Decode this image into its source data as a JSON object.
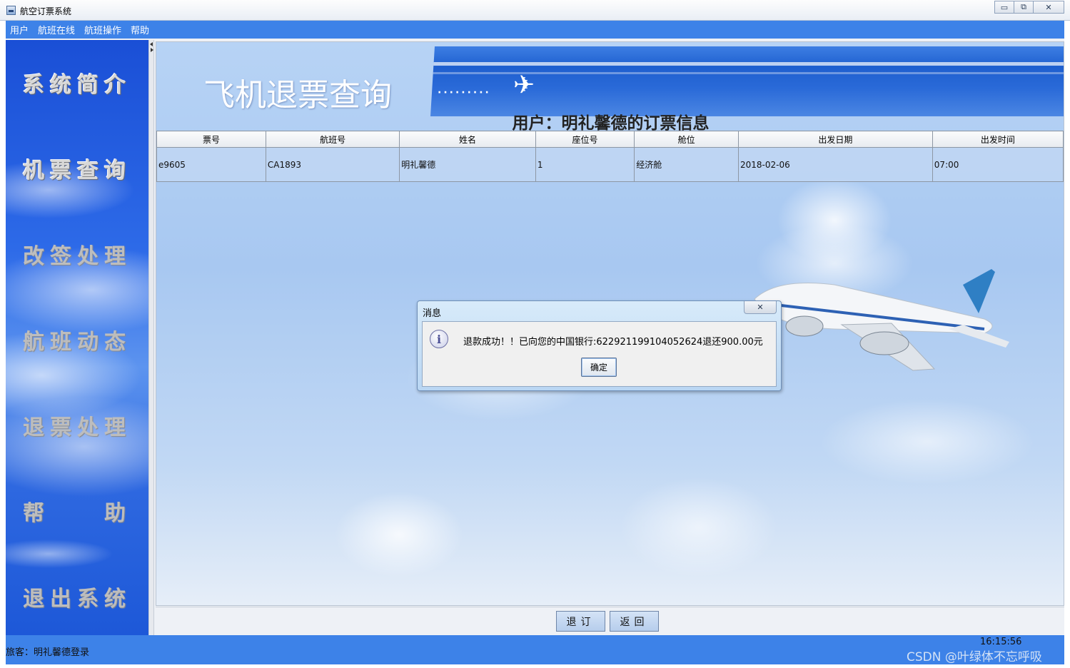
{
  "window": {
    "title": "航空订票系统",
    "controls": {
      "minimize": "▭",
      "maximize": "⧉",
      "close": "✕"
    }
  },
  "menu": [
    "用户",
    "航班在线",
    "航班操作",
    "帮助"
  ],
  "sidebar": {
    "items": [
      {
        "label": "系统简介"
      },
      {
        "label": "机票查询"
      },
      {
        "label": "改签处理"
      },
      {
        "label": "航班动态"
      },
      {
        "label": "退票处理"
      },
      {
        "label": "帮　　助"
      },
      {
        "label": "退出系统"
      }
    ]
  },
  "banner": {
    "title": "飞机退票查询",
    "dots": "·········",
    "plane_glyph": "✈"
  },
  "caption": "用户：明礼馨德的订票信息",
  "table": {
    "columns": [
      "票号",
      "航班号",
      "姓名",
      "座位号",
      "舱位",
      "出发日期",
      "出发时间"
    ],
    "rows": [
      [
        "e9605",
        "CA1893",
        "明礼馨德",
        "1",
        "经济舱",
        "2018-02-06",
        "07:00"
      ]
    ]
  },
  "buttons": {
    "refund": "退订",
    "back": "返回"
  },
  "status": {
    "user": "旅客：明礼馨德登录",
    "time": "16:15:56",
    "watermark": "CSDN @叶绿体不忘呼吸"
  },
  "dialog": {
    "title": "消息",
    "close": "✕",
    "icon": "i",
    "message": "退款成功！！已向您的中国银行:6229211991040526​24退还900.00元",
    "ok": "确定"
  },
  "colors": {
    "menubar": "#3d82e8",
    "sidebar": "#2d6ae8",
    "dialog": "#b9d6f3"
  }
}
